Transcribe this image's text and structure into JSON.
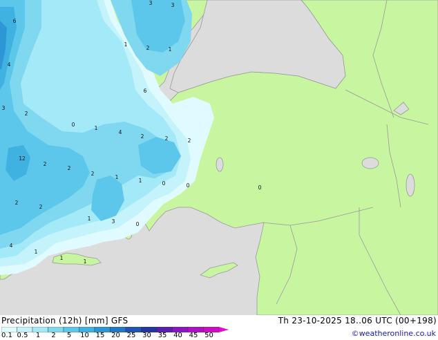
{
  "title": "Precipitation (12h) [mm] GFS",
  "valid_time": "Th 23-10-2025 18..06 UTC (00+198)",
  "credit": "©weatheronline.co.uk",
  "colors": {
    "sea": "#dcdcdc",
    "land": "#c8f5a0",
    "border": "#999999",
    "precip_levels": [
      "#e0fbff",
      "#c4f3fb",
      "#a4e9f7",
      "#7fd8f0",
      "#5cc7ea",
      "#3fb2e2",
      "#2d97d6",
      "#2277c8",
      "#1f56b4",
      "#2237a0",
      "#5a1fb0",
      "#8a17c0",
      "#b010c8",
      "#d00cc8",
      "#e40bd0"
    ]
  },
  "legend": {
    "labels": [
      "0.1",
      "0.5",
      "1",
      "2",
      "5",
      "10",
      "15",
      "20",
      "25",
      "30",
      "35",
      "40",
      "45",
      "50"
    ]
  },
  "map_labels": [
    "3",
    "3",
    "6",
    "1",
    "2",
    "1",
    "4",
    "3",
    "2",
    "6",
    "0",
    "1",
    "4",
    "2",
    "2",
    "2",
    "2",
    "2",
    "12",
    "2",
    "2",
    "1",
    "1",
    "0",
    "0",
    "2",
    "1",
    "3",
    "0",
    "1",
    "4",
    "1",
    "1",
    "0"
  ]
}
